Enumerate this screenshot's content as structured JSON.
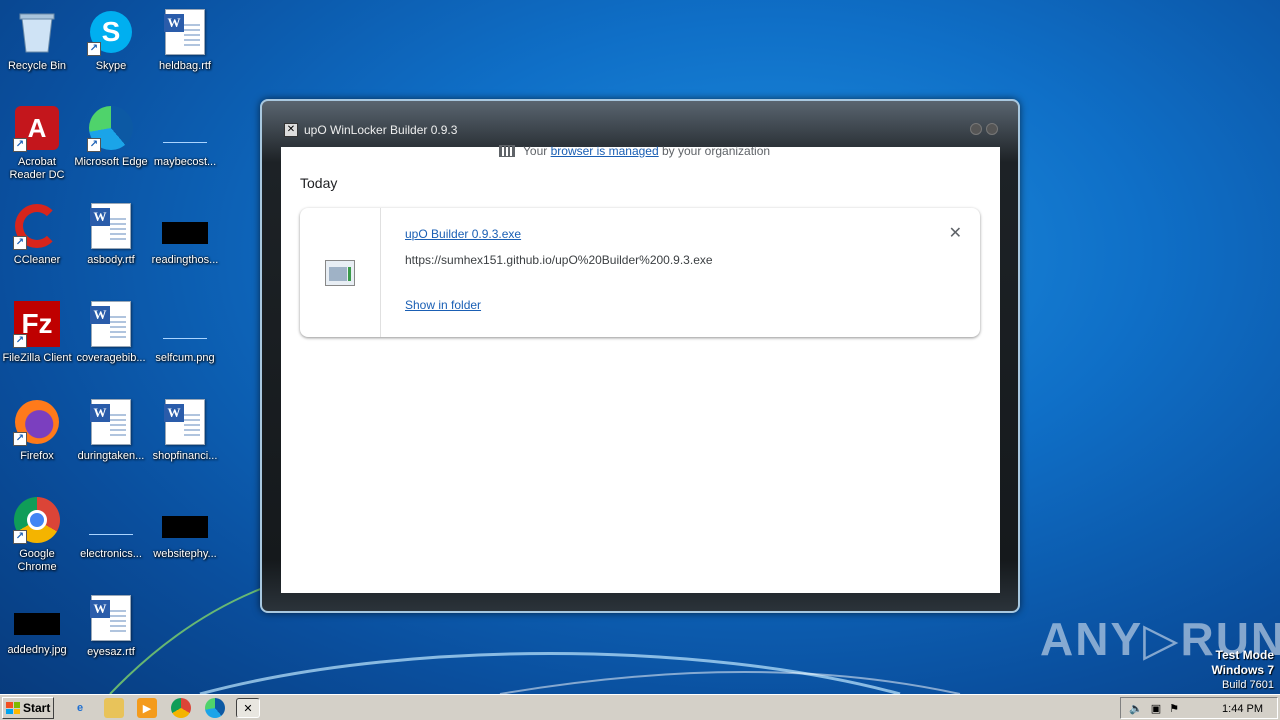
{
  "desktop": {
    "icons": [
      {
        "label": "Recycle Bin"
      },
      {
        "label": "Skype"
      },
      {
        "label": "heldbag.rtf"
      },
      {
        "label": "Acrobat Reader DC"
      },
      {
        "label": "Microsoft Edge"
      },
      {
        "label": "maybecost..."
      },
      {
        "label": "CCleaner"
      },
      {
        "label": "asbody.rtf"
      },
      {
        "label": "readingthos..."
      },
      {
        "label": "FileZilla Client"
      },
      {
        "label": "coveragebib..."
      },
      {
        "label": "selfcum.png"
      },
      {
        "label": "Firefox"
      },
      {
        "label": "duringtaken..."
      },
      {
        "label": "shopfinanci..."
      },
      {
        "label": "Google Chrome"
      },
      {
        "label": "electronics..."
      },
      {
        "label": "websitephy..."
      },
      {
        "label": "addedny.jpg"
      },
      {
        "label": "eyesaz.rtf"
      }
    ]
  },
  "window": {
    "title": "upO WinLocker Builder 0.9.3",
    "app_icon_glyph": "✕",
    "managed": {
      "prefix": "Your",
      "link": "browser is managed",
      "suffix": "by your organization"
    },
    "section_label": "Today",
    "download": {
      "filename": "upO Builder 0.9.3.exe",
      "url": "https://sumhex151.github.io/upO%20Builder%200.9.3.exe",
      "action": "Show in folder",
      "close_glyph": "✕"
    }
  },
  "watermark": {
    "brand": "ANY▷RUN",
    "mode": "Test Mode",
    "os": "Windows 7",
    "build": "Build 7601"
  },
  "taskbar": {
    "start_label": "Start",
    "clock": "1:44 PM"
  },
  "colors": {
    "link": "#1a5fb4",
    "taskbar": "#d4d0c8",
    "desktop": "#0f6fc7"
  }
}
